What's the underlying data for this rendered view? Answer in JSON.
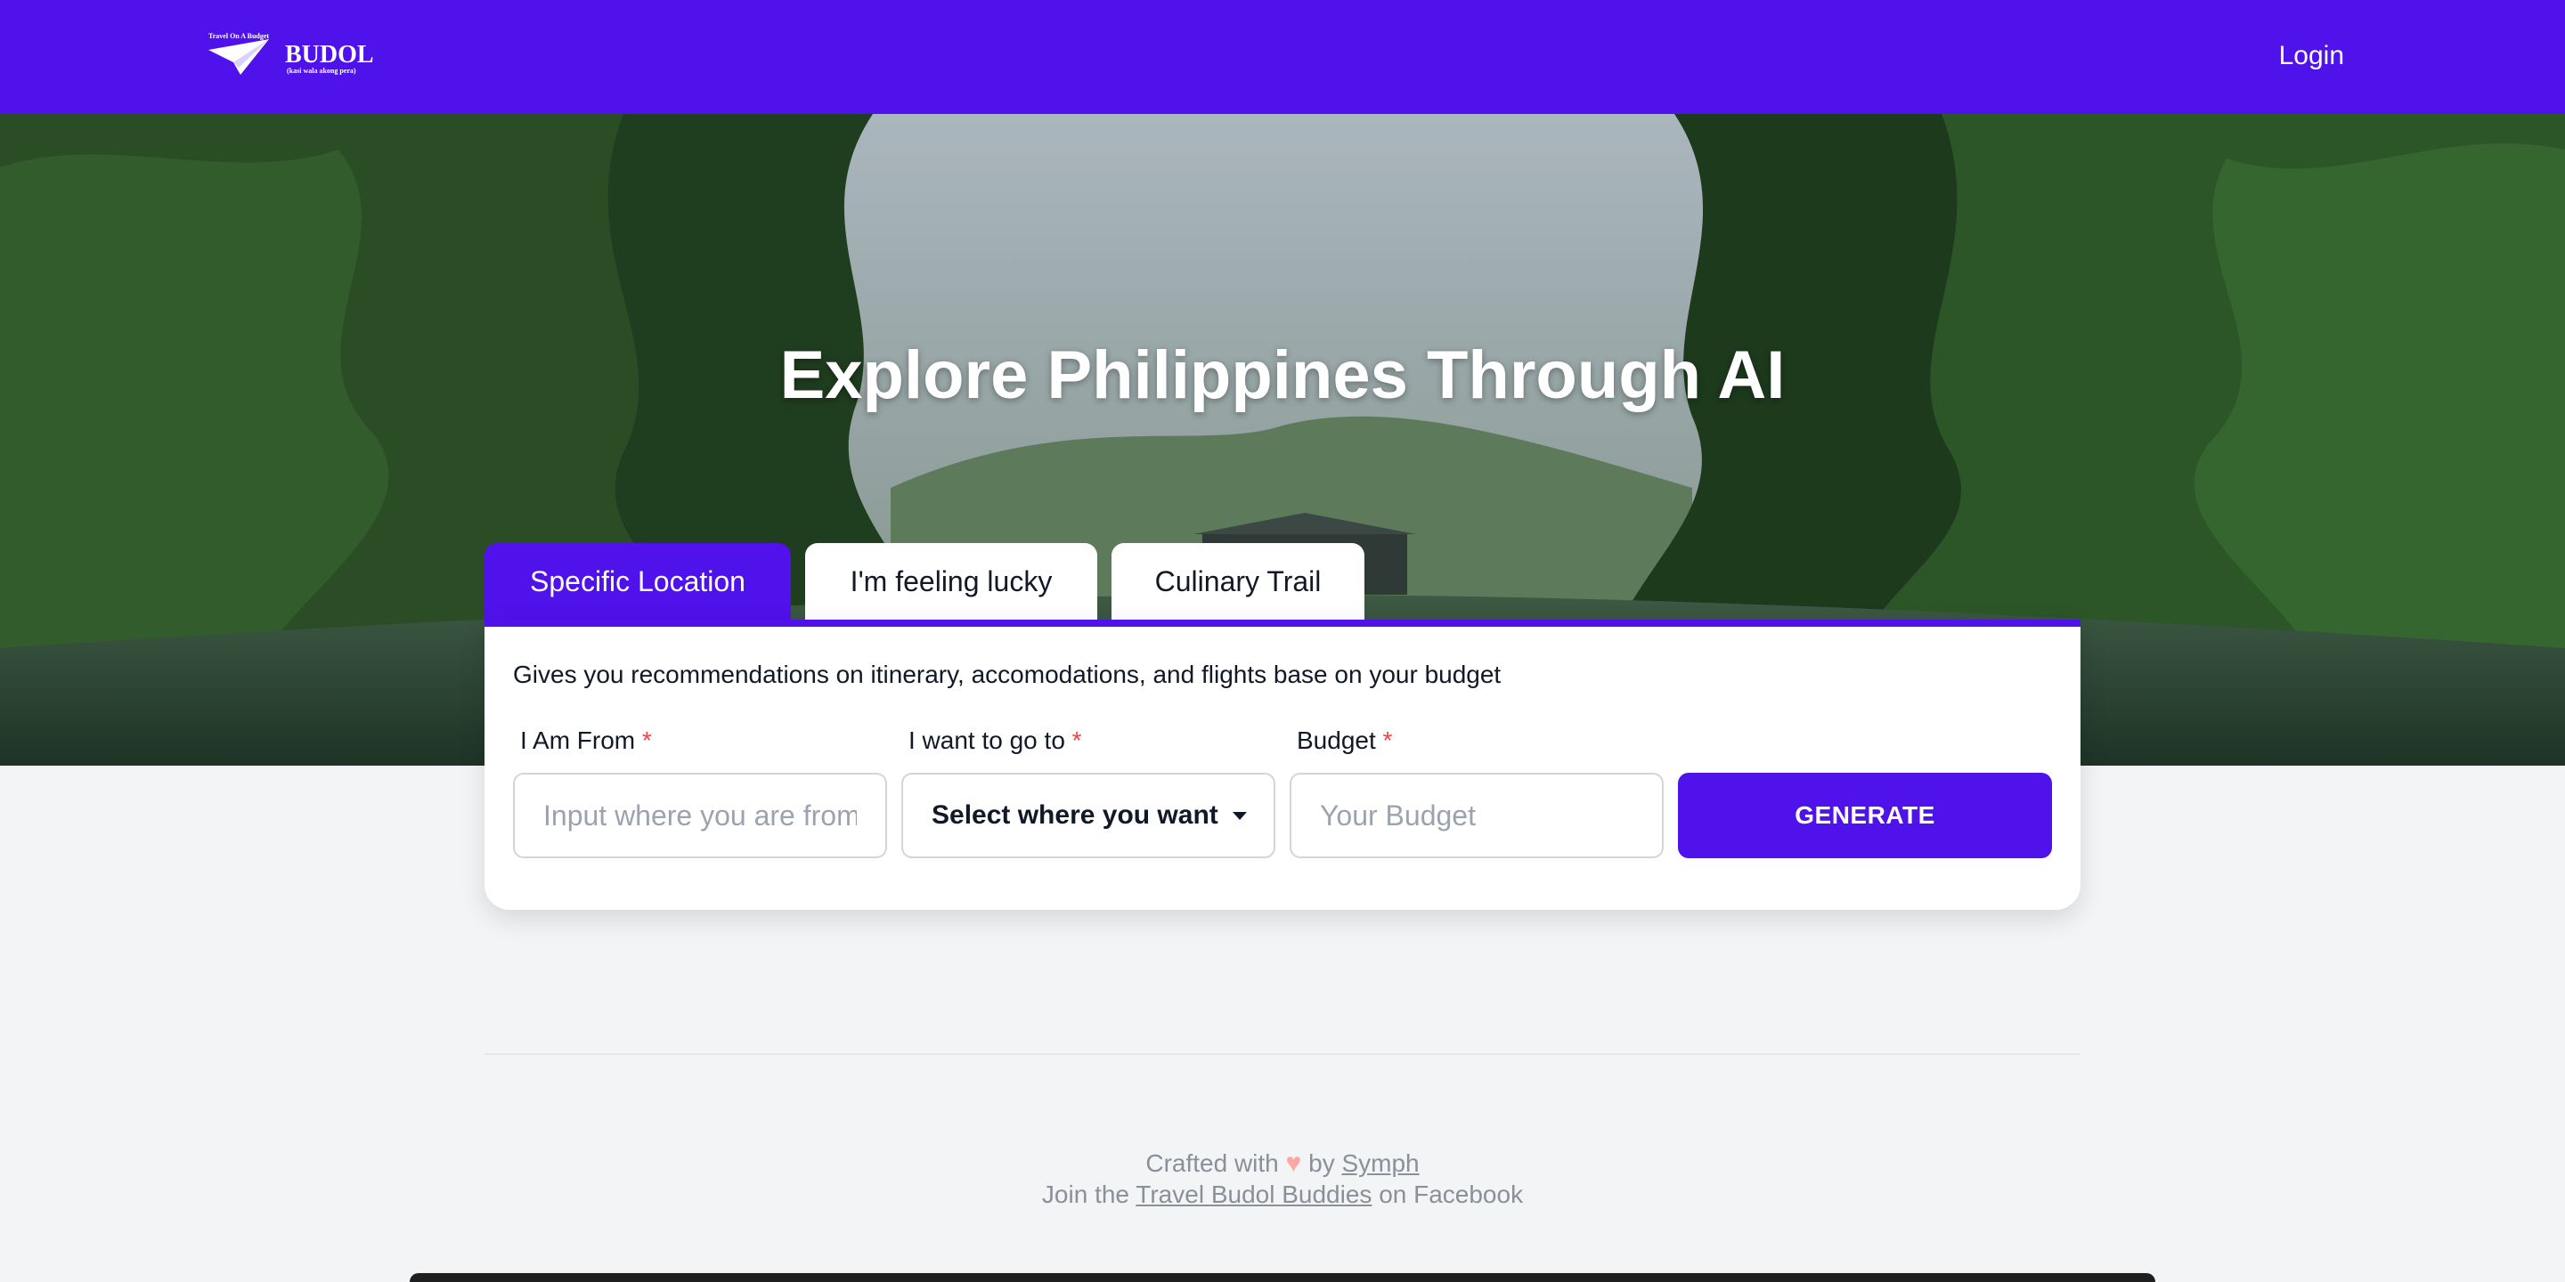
{
  "header": {
    "logo_tagline": "Travel On A Budget",
    "logo_name": "BUDOL",
    "logo_sub": "(kasi wala akong pera)",
    "login_label": "Login",
    "bg_color": "#4f12ea"
  },
  "hero": {
    "title": "Explore Philippines Through AI"
  },
  "tabs": [
    {
      "label": "Specific Location",
      "active": true
    },
    {
      "label": "I'm feeling lucky",
      "active": false
    },
    {
      "label": "Culinary Trail",
      "active": false
    }
  ],
  "form": {
    "description": "Gives you recommendations on itinerary, accomodations, and flights base on your budget",
    "from_label": "I Am From",
    "from_placeholder": "Input where you are from",
    "to_label": "I want to go to",
    "to_value": "Select where you want",
    "budget_label": "Budget",
    "budget_placeholder": "Your Budget",
    "required_mark": "*",
    "generate_label": "GENERATE"
  },
  "footer": {
    "crafted_prefix": "Crafted with",
    "heart": "♥",
    "by_text": "by",
    "author_link": "Symph",
    "join_prefix": "Join the",
    "group_link": "Travel Budol Buddies",
    "join_suffix": "on Facebook"
  },
  "colors": {
    "accent": "#4f12ea",
    "required": "#ef4444"
  }
}
